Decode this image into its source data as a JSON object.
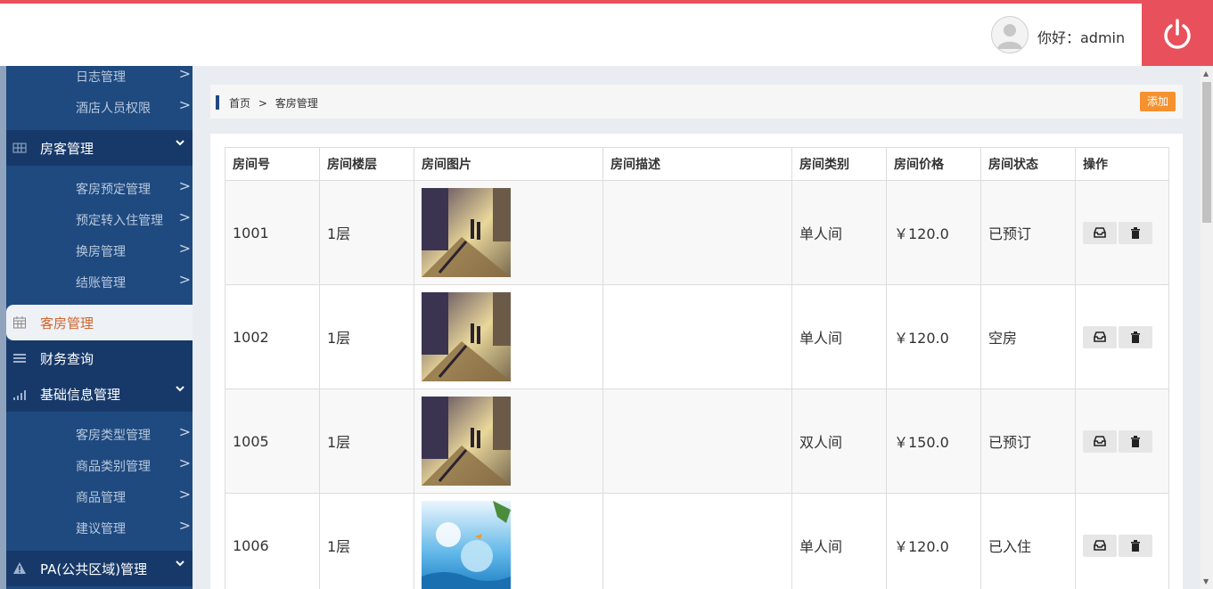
{
  "header": {
    "greeting": "你好：admin"
  },
  "sidebar": {
    "items": [
      {
        "label": "日志管理",
        "type": "sub"
      },
      {
        "label": "酒店人员权限",
        "type": "sub"
      },
      {
        "label": "房客管理",
        "type": "head"
      },
      {
        "label": "客房预定管理",
        "type": "sub"
      },
      {
        "label": "预定转入住管理",
        "type": "sub"
      },
      {
        "label": "换房管理",
        "type": "sub"
      },
      {
        "label": "结账管理",
        "type": "sub"
      },
      {
        "label": "客房管理",
        "type": "active"
      },
      {
        "label": "财务查询",
        "type": "head"
      },
      {
        "label": "基础信息管理",
        "type": "head"
      },
      {
        "label": "客房类型管理",
        "type": "sub"
      },
      {
        "label": "商品类别管理",
        "type": "sub"
      },
      {
        "label": "商品管理",
        "type": "sub"
      },
      {
        "label": "建议管理",
        "type": "sub"
      },
      {
        "label": "PA(公共区域)管理",
        "type": "head"
      }
    ],
    "arrow": ">",
    "chevron": "˅"
  },
  "breadcrumb": {
    "home": "首页",
    "sep": ">",
    "current": "客房管理"
  },
  "actions": {
    "add_label": "添加"
  },
  "table": {
    "columns": [
      "房间号",
      "房间楼层",
      "房间图片",
      "房间描述",
      "房间类别",
      "房间价格",
      "房间状态",
      "操作"
    ],
    "rows": [
      {
        "number": "1001",
        "floor": "1层",
        "image": "street-photo",
        "description": "",
        "type": "单人间",
        "price": "￥120.0",
        "status": "已预订"
      },
      {
        "number": "1002",
        "floor": "1层",
        "image": "street-photo",
        "description": "",
        "type": "单人间",
        "price": "￥120.0",
        "status": "空房"
      },
      {
        "number": "1005",
        "floor": "1层",
        "image": "street-photo",
        "description": "",
        "type": "双人间",
        "price": "￥150.0",
        "status": "已预订"
      },
      {
        "number": "1006",
        "floor": "1层",
        "image": "ocean-photo",
        "description": "",
        "type": "单人间",
        "price": "￥120.0",
        "status": "已入住"
      }
    ]
  },
  "colors": {
    "accent": "#e8505b",
    "sidebar": "#1f4a80",
    "add_button": "#f5922f",
    "active_text": "#d0652f"
  },
  "icons": [
    "user-avatar-icon",
    "power-icon",
    "grid-icon",
    "calendar-icon",
    "list-icon",
    "signal-icon",
    "warning-icon",
    "inbox-icon",
    "trash-icon"
  ]
}
